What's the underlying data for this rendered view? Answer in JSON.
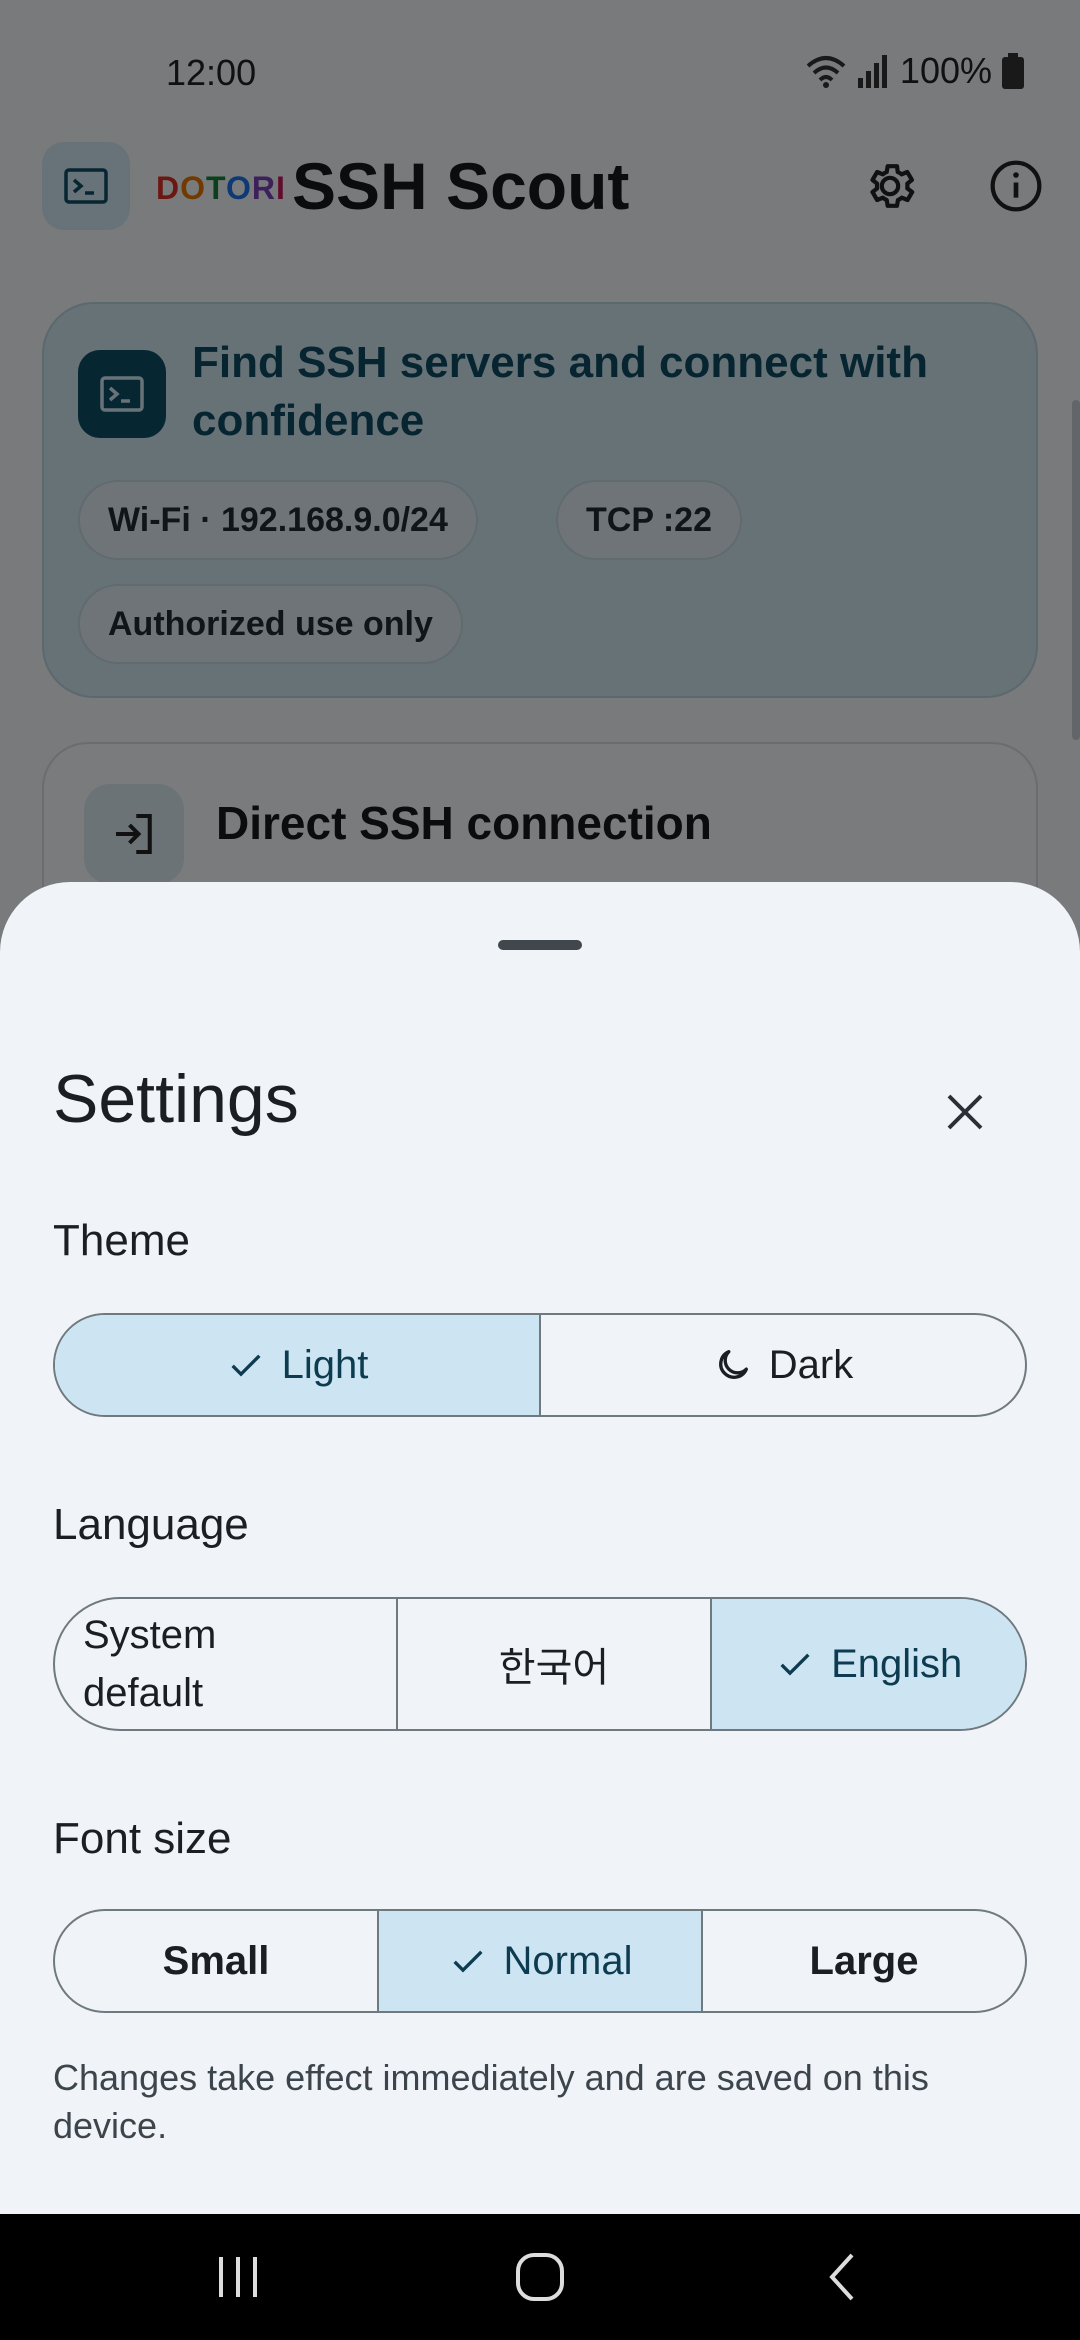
{
  "status_bar": {
    "time": "12:00",
    "battery": "100%"
  },
  "app_bar": {
    "brand_letters": [
      "D",
      "O",
      "T",
      "O",
      "R",
      "I"
    ],
    "title": "SSH Scout"
  },
  "hero": {
    "title": "Find SSH servers and connect with confidence",
    "chips": [
      "Wi-Fi · 192.168.9.0/24",
      "TCP :22",
      "Authorized use only"
    ]
  },
  "direct_card": {
    "title": "Direct SSH connection"
  },
  "settings_sheet": {
    "title": "Settings",
    "theme": {
      "label": "Theme",
      "options": [
        {
          "label": "Light",
          "selected": true,
          "icon": "check-icon"
        },
        {
          "label": "Dark",
          "selected": false,
          "icon": "moon-icon"
        }
      ]
    },
    "language": {
      "label": "Language",
      "options": [
        {
          "label": "System default",
          "selected": false
        },
        {
          "label": "한국어",
          "selected": false
        },
        {
          "label": "English",
          "selected": true,
          "icon": "check-icon"
        }
      ]
    },
    "font_size": {
      "label": "Font size",
      "options": [
        {
          "label": "Small",
          "selected": false
        },
        {
          "label": "Normal",
          "selected": true,
          "icon": "check-icon"
        },
        {
          "label": "Large",
          "selected": false
        }
      ]
    },
    "hint": "Changes take effect immediately and are saved on this device."
  },
  "colors": {
    "selected_segment": "#cde5f3",
    "hero_background": "#cfe5ef",
    "hero_title": "#0f4b63",
    "sheet_background": "#f0f4f9"
  }
}
